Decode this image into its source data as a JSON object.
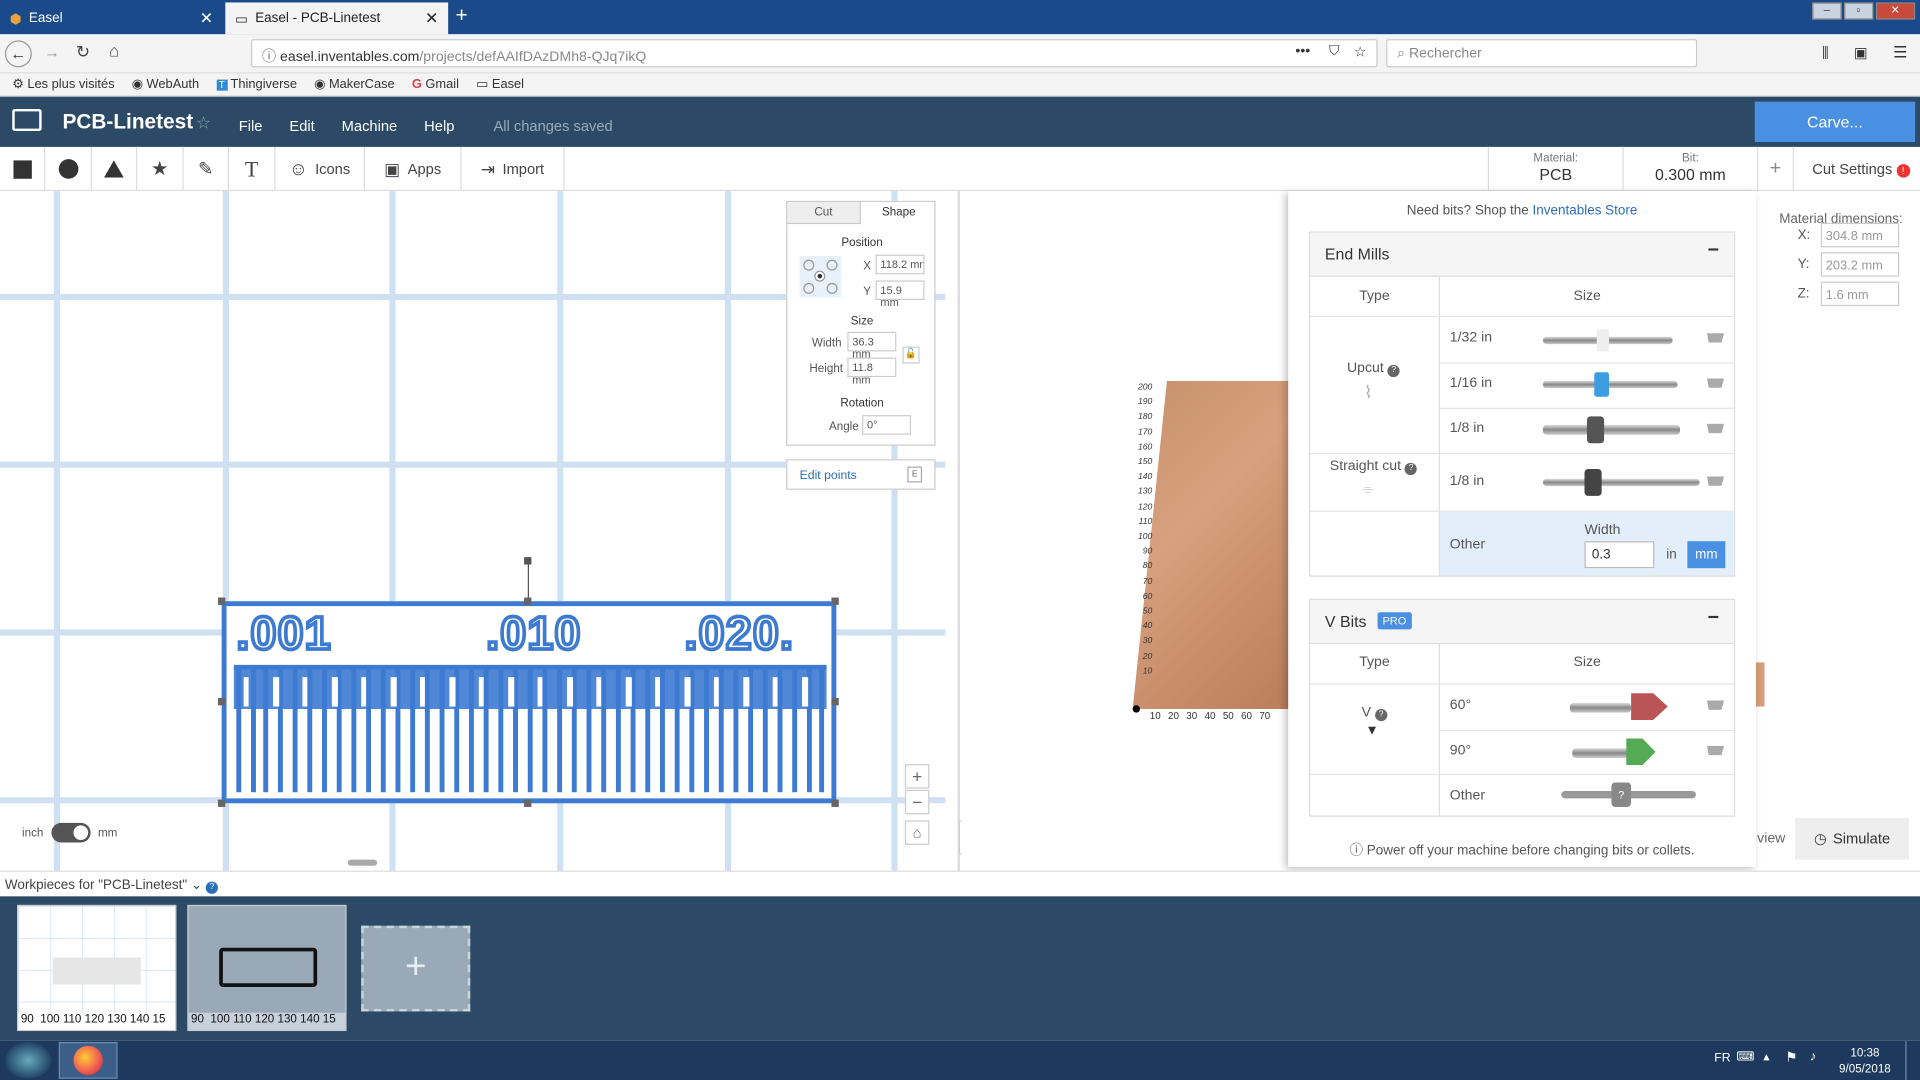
{
  "browser": {
    "tabs": [
      {
        "title": "Easel"
      },
      {
        "title": "Easel - PCB-Linetest"
      }
    ],
    "url_domain": "easel.inventables.com",
    "url_path": "/projects/defAAIfDAzDMh8-QJq7ikQ",
    "search_placeholder": "Rechercher",
    "bookmarks": [
      "Les plus visités",
      "WebAuth",
      "Thingiverse",
      "MakerCase",
      "Gmail",
      "Easel"
    ]
  },
  "app": {
    "title": "PCB-Linetest",
    "menu": [
      "File",
      "Edit",
      "Machine",
      "Help"
    ],
    "status": "All changes saved",
    "carve_label": "Carve..."
  },
  "toolbar": {
    "icons_label": "Icons",
    "apps_label": "Apps",
    "import_label": "Import",
    "material_caption": "Material:",
    "material_value": "PCB",
    "bit_caption": "Bit:",
    "bit_value": "0.300 mm",
    "plus": "+",
    "cut_settings": "Cut Settings"
  },
  "inspector": {
    "tab_cut": "Cut",
    "tab_shape": "Shape",
    "position_title": "Position",
    "x_label": "X",
    "x_value": "118.2 mm",
    "y_label": "Y",
    "y_value": "15.9 mm",
    "size_title": "Size",
    "width_label": "Width",
    "width_value": "36.3 mm",
    "height_label": "Height",
    "height_value": "11.8 mm",
    "rotation_title": "Rotation",
    "angle_label": "Angle",
    "angle_value": "0°",
    "edit_points": "Edit points",
    "edit_key": "E"
  },
  "design": {
    "labels": [
      ".001",
      ".010",
      ".020."
    ]
  },
  "units": {
    "inch": "inch",
    "mm": "mm"
  },
  "preview": {
    "y_ticks": [
      "200",
      "190",
      "180",
      "170",
      "160",
      "150",
      "140",
      "130",
      "120",
      "110",
      "100",
      "90",
      "80",
      "70",
      "60",
      "50",
      "40",
      "30",
      "20",
      "10"
    ],
    "x_ticks": [
      "10",
      "20",
      "30",
      "40",
      "50",
      "60",
      "70"
    ],
    "view_label": "view",
    "simulate_label": "Simulate"
  },
  "material_dims": {
    "title": "Material dimensions:",
    "x_label": "X:",
    "x": "304.8 mm",
    "y_label": "Y:",
    "y": "203.2 mm",
    "z_label": "Z:",
    "z": "1.6 mm"
  },
  "bits_panel": {
    "need_bits": "Need bits? Shop the ",
    "store_link": "Inventables Store",
    "end_mills": {
      "title": "End Mills",
      "type_col": "Type",
      "size_col": "Size",
      "upcut": "Upcut",
      "straight": "Straight cut",
      "sizes": [
        "1/32 in",
        "1/16 in",
        "1/8 in",
        "1/8 in"
      ],
      "other": "Other",
      "width_label": "Width",
      "width_value": "0.3",
      "unit_in": "in",
      "unit_mm": "mm"
    },
    "v_bits": {
      "title": "V Bits",
      "badge": "PRO",
      "type_col": "Type",
      "size_col": "Size",
      "v": "V",
      "sizes": [
        "60°",
        "90°"
      ],
      "other": "Other"
    },
    "collapse": "−",
    "footer": "Power off your machine before changing bits or collets."
  },
  "workpieces": {
    "label": "Workpieces for \"PCB-Linetest\"",
    "ruler": "90  100 110 120 130 140 15"
  },
  "taskbar": {
    "lang": "FR",
    "time": "10:38",
    "date": "9/05/2018"
  }
}
